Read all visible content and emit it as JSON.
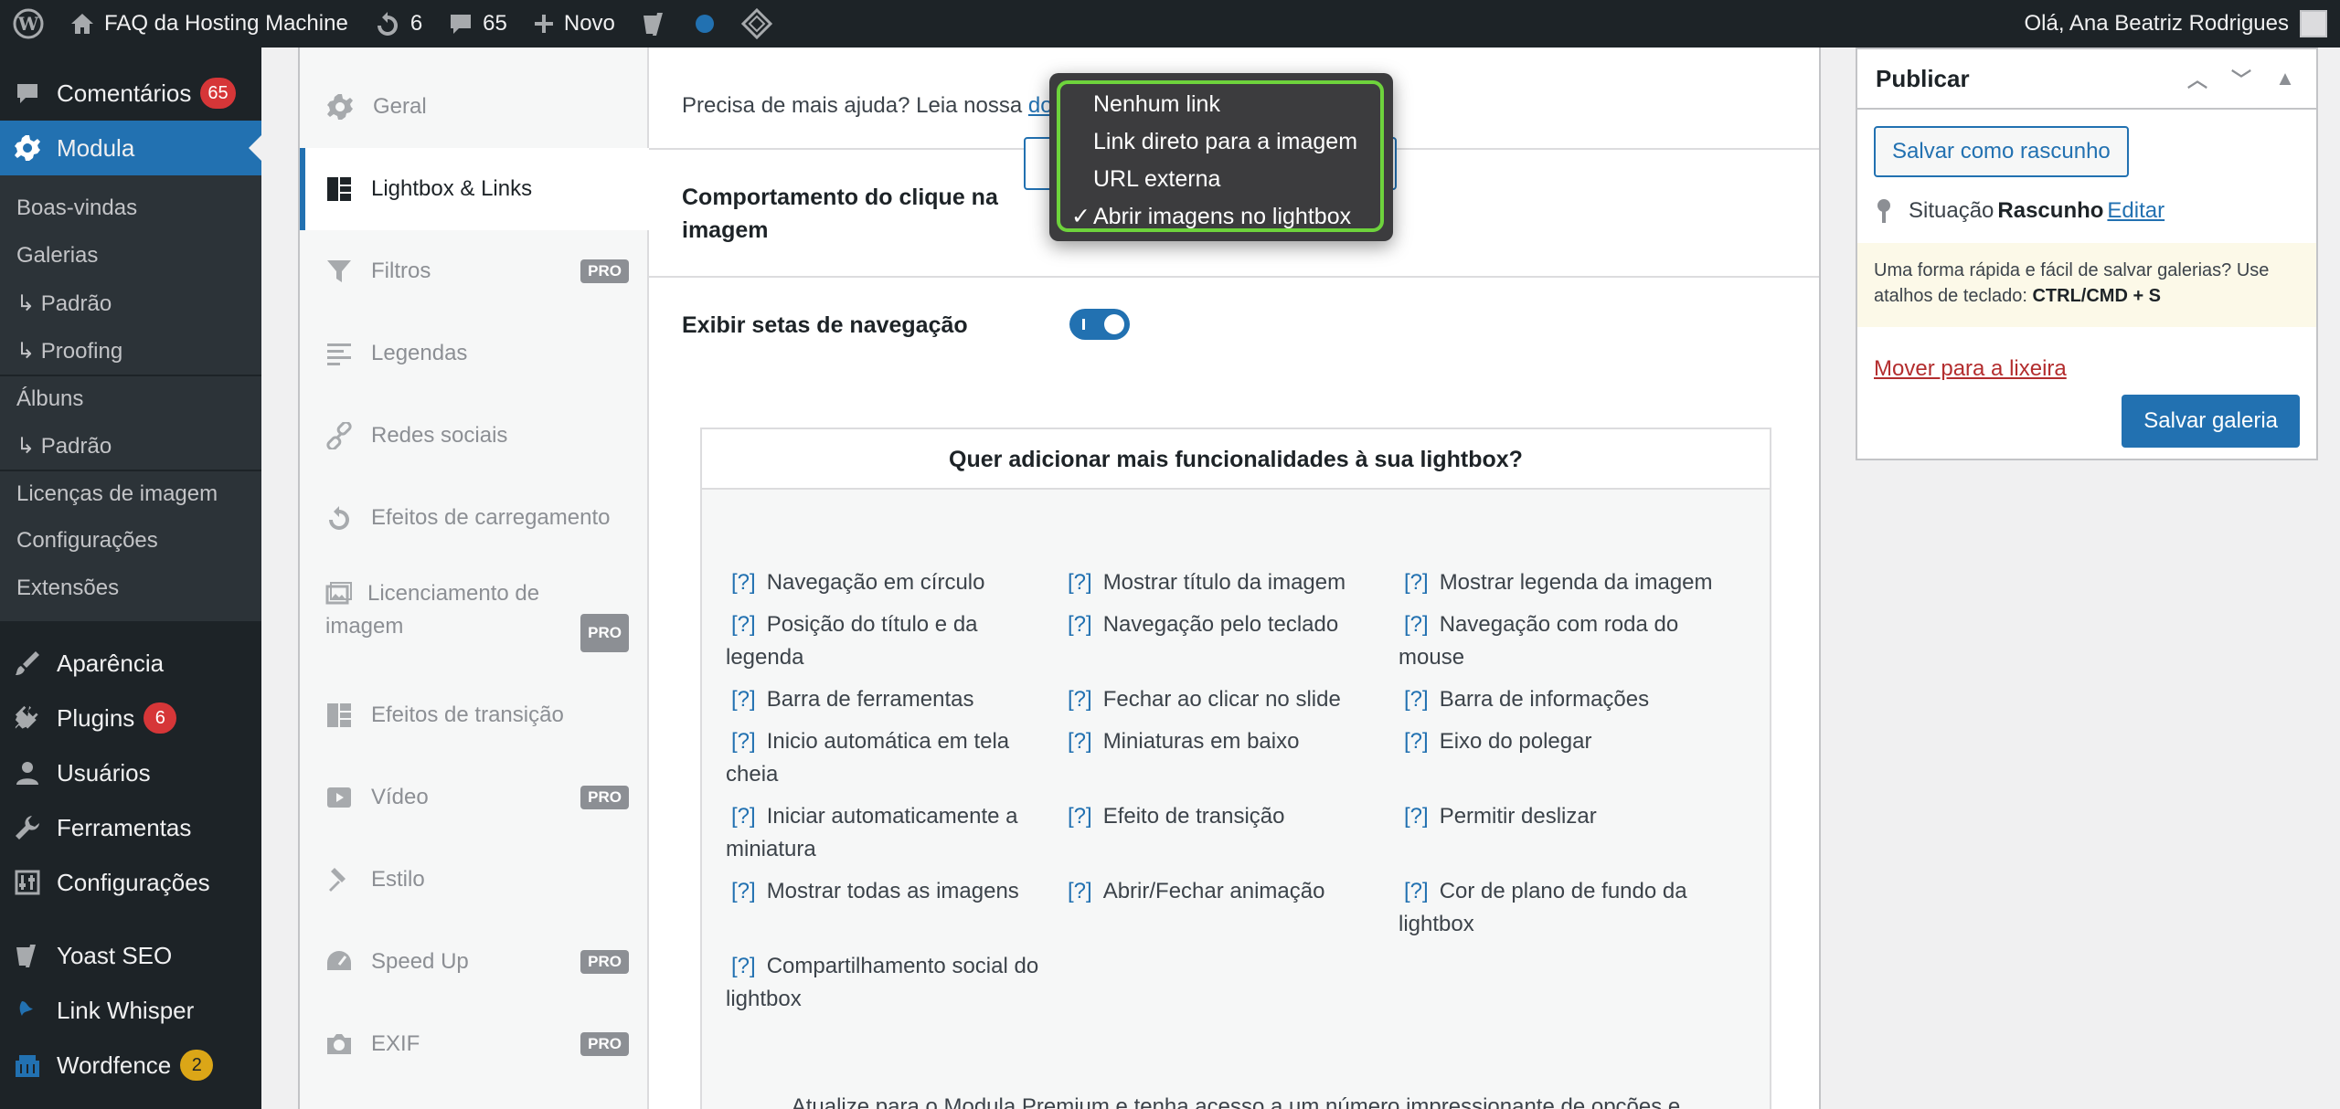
{
  "adminbar": {
    "site_name": "FAQ da Hosting Machine",
    "updates_count": "6",
    "comments_count": "65",
    "new_label": "Novo",
    "greeting": "Olá, Ana Beatriz Rodrigues"
  },
  "sidebar": {
    "items": [
      {
        "label": "Comentários",
        "badge": "65"
      },
      {
        "label": "Modula"
      },
      {
        "label": "Aparência"
      },
      {
        "label": "Plugins",
        "badge": "6"
      },
      {
        "label": "Usuários"
      },
      {
        "label": "Ferramentas"
      },
      {
        "label": "Configurações"
      },
      {
        "label": "Yoast SEO"
      },
      {
        "label": "Link Whisper"
      },
      {
        "label": "Wordfence",
        "badge": "2"
      }
    ],
    "submenu": [
      "Boas-vindas",
      "Galerias",
      "↳ Padrão",
      "↳ Proofing",
      "Álbuns",
      "↳ Padrão",
      "Licenças de imagem",
      "Configurações",
      "Extensões"
    ]
  },
  "tabs": [
    {
      "label": "Geral",
      "pro": false
    },
    {
      "label": "Lightbox & Links",
      "pro": false
    },
    {
      "label": "Filtros",
      "pro": true
    },
    {
      "label": "Legendas",
      "pro": false
    },
    {
      "label": "Redes sociais",
      "pro": false
    },
    {
      "label": "Efeitos de carregamento",
      "pro": false
    },
    {
      "label": "Licenciamento de imagem",
      "pro": true
    },
    {
      "label": "Efeitos de transição",
      "pro": false
    },
    {
      "label": "Vídeo",
      "pro": true
    },
    {
      "label": "Estilo",
      "pro": false
    },
    {
      "label": "Speed Up",
      "pro": true
    },
    {
      "label": "EXIF",
      "pro": true
    }
  ],
  "pro_label": "PRO",
  "settings": {
    "help_text": "Precisa de mais ajuda? Leia nossa ",
    "help_link": "do",
    "click_behavior_label": "Comportamento do clique na imagem",
    "nav_arrows_label": "Exibir setas de navegação"
  },
  "dropdown": {
    "options": [
      "Nenhum link",
      "Link direto para a imagem",
      "URL externa",
      "Abrir imagens no lightbox"
    ],
    "check": "✓"
  },
  "upsell": {
    "title": "Quer adicionar mais funcionalidades à sua lightbox?",
    "q": "[?]",
    "features": [
      "Navegação em círculo",
      "Mostrar título da imagem",
      "Mostrar legenda da imagem",
      "Posição do título e da legenda",
      "Navegação pelo teclado",
      "Navegação com roda do mouse",
      "Barra de ferramentas",
      "Fechar ao clicar no slide",
      "Barra de informações",
      "Inicio automática em tela cheia",
      "Miniaturas em baixo",
      "Eixo do polegar",
      "Iniciar automaticamente a miniatura",
      "Efeito de transição",
      "Permitir deslizar",
      "Mostrar todas as imagens",
      "Abrir/Fechar animação",
      "Cor de plano de fundo da lightbox",
      "Compartilhamento social do lightbox"
    ],
    "footer": "Atualize para o Modula Premium e tenha acesso a um número impressionante de opções e"
  },
  "publish": {
    "title": "Publicar",
    "save_draft": "Salvar como rascunho",
    "status_label": "Situação",
    "status_value": "Rascunho",
    "edit_link": "Editar",
    "notice_text": "Uma forma rápida e fácil de salvar galerias? Use atalhos de teclado: ",
    "notice_shortcut": "CTRL/CMD + S",
    "trash": "Mover para a lixeira",
    "save_gallery": "Salvar galeria"
  },
  "colors": {
    "accent": "#2271b1",
    "highlight": "#6ed33c",
    "danger": "#d63638"
  }
}
